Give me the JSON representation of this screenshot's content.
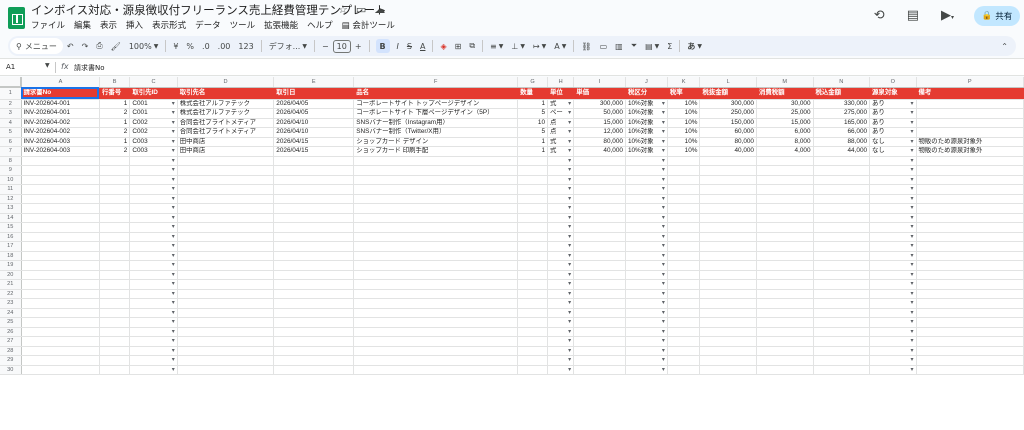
{
  "doc": {
    "title": "インボイス対応・源泉徴収付フリーランス売上経費管理テンプレート",
    "title_icons": [
      "star-icon",
      "folder-move-icon",
      "cloud-status-icon"
    ],
    "menu": [
      "ファイル",
      "編集",
      "表示",
      "挿入",
      "表示形式",
      "データ",
      "ツール",
      "拡張機能",
      "ヘルプ",
      "会計ツール"
    ],
    "share_label": "共有"
  },
  "toolbar": {
    "menu_search": "メニュー",
    "zoom": "100%",
    "currency": "¥",
    "percent": "%",
    "decrease_decimal": ".0",
    "increase_decimal": ".00",
    "number_format": "123",
    "font": "デフォ...",
    "font_size": "10",
    "bold": "B",
    "italic": "I",
    "strike": "S",
    "underline_a": "A",
    "ime": "あ"
  },
  "formula_bar": {
    "cell_ref": "A1",
    "fx": "fx",
    "value": "請求書No"
  },
  "sheet": {
    "columns": [
      "A",
      "B",
      "C",
      "D",
      "E",
      "F",
      "G",
      "H",
      "I",
      "J",
      "K",
      "L",
      "M",
      "N",
      "O",
      "P"
    ],
    "headers": [
      "請求書No",
      "行番号",
      "取引先ID",
      "取引先名",
      "取引日",
      "品名",
      "数量",
      "単位",
      "単価",
      "税区分",
      "税率",
      "税抜金額",
      "消費税額",
      "税込金額",
      "源泉対象",
      "備考"
    ],
    "rows": [
      [
        "INV-202604-001",
        "1",
        "C001",
        "株式会社アルファテック",
        "2026/04/05",
        "コーポレートサイト トップページデザイン",
        "1",
        "式",
        "300,000",
        "10%対象",
        "10%",
        "300,000",
        "30,000",
        "330,000",
        "あり",
        ""
      ],
      [
        "INV-202604-001",
        "2",
        "C001",
        "株式会社アルファテック",
        "2026/04/05",
        "コーポレートサイト 下層ページデザイン（5P）",
        "5",
        "ペー",
        "50,000",
        "10%対象",
        "10%",
        "250,000",
        "25,000",
        "275,000",
        "あり",
        ""
      ],
      [
        "INV-202604-002",
        "1",
        "C002",
        "合同会社ブライトメディア",
        "2026/04/10",
        "SNSバナー制作（Instagram用）",
        "10",
        "点",
        "15,000",
        "10%対象",
        "10%",
        "150,000",
        "15,000",
        "165,000",
        "あり",
        ""
      ],
      [
        "INV-202604-002",
        "2",
        "C002",
        "合同会社ブライトメディア",
        "2026/04/10",
        "SNSバナー制作（Twitter/X用）",
        "5",
        "点",
        "12,000",
        "10%対象",
        "10%",
        "60,000",
        "6,000",
        "66,000",
        "あり",
        ""
      ],
      [
        "INV-202604-003",
        "1",
        "C003",
        "田中商店",
        "2026/04/15",
        "ショップカード デザイン",
        "1",
        "式",
        "80,000",
        "10%対象",
        "10%",
        "80,000",
        "8,000",
        "88,000",
        "なし",
        "物販のため源泉対象外"
      ],
      [
        "INV-202604-003",
        "2",
        "C003",
        "田中商店",
        "2026/04/15",
        "ショップカード 印刷手配",
        "1",
        "式",
        "40,000",
        "10%対象",
        "10%",
        "40,000",
        "4,000",
        "44,000",
        "なし",
        "物販のため源泉対象外"
      ]
    ],
    "empty_rows_from": 8,
    "empty_rows_to": 30,
    "accent_color": "#e53b31"
  }
}
